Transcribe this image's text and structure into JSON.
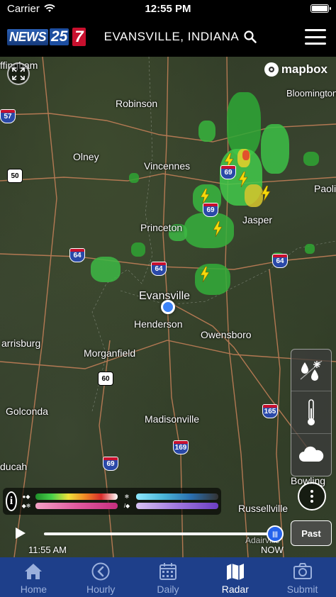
{
  "status_bar": {
    "carrier": "Carrier",
    "time": "12:55 PM"
  },
  "header": {
    "logo_news": "NEWS",
    "logo_25": "25",
    "logo_7": "7",
    "location": "EVANSVILLE, INDIANA"
  },
  "map": {
    "attribution": "mapbox",
    "cities": [
      {
        "name": "ffingham"
      },
      {
        "name": "Robinson"
      },
      {
        "name": "Bloomington"
      },
      {
        "name": "Olney"
      },
      {
        "name": "Vincennes"
      },
      {
        "name": "Paoli"
      },
      {
        "name": "Jasper"
      },
      {
        "name": "Princeton"
      },
      {
        "name": "Evansville"
      },
      {
        "name": "Henderson"
      },
      {
        "name": "Owensboro"
      },
      {
        "name": "arrisburg"
      },
      {
        "name": "Morganfield"
      },
      {
        "name": "Golconda"
      },
      {
        "name": "Madisonville"
      },
      {
        "name": "ducah"
      },
      {
        "name": "Bowling"
      },
      {
        "name": "Russellville"
      },
      {
        "name": "Adairville"
      }
    ],
    "shields": [
      "57",
      "50",
      "69",
      "69",
      "64",
      "64",
      "64",
      "60",
      "165",
      "169",
      "69"
    ]
  },
  "playback": {
    "start_time": "11:55 AM",
    "end_time": "NOW",
    "past_label": "Past",
    "progress": 1.0
  },
  "tabs": [
    {
      "label": "Home",
      "icon": "home-icon"
    },
    {
      "label": "Hourly",
      "icon": "clock-icon"
    },
    {
      "label": "Daily",
      "icon": "calendar-icon"
    },
    {
      "label": "Radar",
      "icon": "map-icon",
      "active": true
    },
    {
      "label": "Submit",
      "icon": "camera-icon"
    }
  ],
  "colors": {
    "tab_bar": "#1e3f8a",
    "active_tab": "#ffffff",
    "inactive_tab": "#9bb0dc",
    "location_dot": "#3b82f6",
    "radar_green": "#37c43a",
    "lightning": "#f5d90a"
  }
}
